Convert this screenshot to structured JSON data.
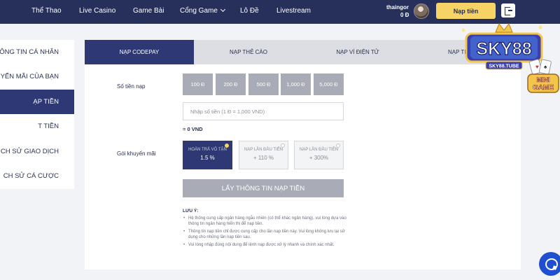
{
  "nav": {
    "items": [
      "Thể Thao",
      "Live Casino",
      "Game Bài",
      "Cổng Game",
      "Lô Đề",
      "Livestream"
    ],
    "user_name": "thaingor",
    "balance": "0 Đ",
    "deposit_label": "Nạp tiền"
  },
  "sidebar": {
    "items": [
      "ÔNG TIN CÁ NHÂN",
      "UYẾN MÃI CỦA BẠN",
      "ẠP TIỀN",
      "T TIỀN",
      "CH SỬ GIAO DỊCH",
      "CH SỬ CÁ CƯỢC"
    ],
    "active_index": 2
  },
  "tabs": {
    "items": [
      "NẠP CODEPAY",
      "NẠP THẺ CÀO",
      "NẠP VÍ ĐIỆN TỬ",
      "NẠP TIỀ"
    ],
    "active_index": 0
  },
  "form": {
    "amount_label": "Số tiền nạp",
    "amount_options": [
      "100 Đ",
      "200 Đ",
      "500 Đ",
      "1,000 Đ",
      "5,000 Đ"
    ],
    "input_placeholder": "Nhập số tiền (1 Đ = 1,000 VND)",
    "converted": "= 0 VND",
    "promo_label": "Gói khuyến mãi",
    "promos": [
      {
        "title": "HOÀN TRẢ VÔ TẬN",
        "value": "1.5 %"
      },
      {
        "title": "NẠP LẦN ĐẦU TIÊN",
        "value": "+ 110 %"
      },
      {
        "title": "NẠP LẦN ĐẦU TIÊN",
        "value": "+ 300%"
      }
    ],
    "promo_active_index": 0,
    "submit_label": "LẤY THÔNG TIN NẠP TIỀN"
  },
  "notes": {
    "title": "LƯU Ý:",
    "items": [
      "Hệ thống cung cấp ngân hàng ngẫu nhiên (có thể khác ngân hàng), vui lòng dựa vào thông tin ngân hàng hiển thị để nạp tiền.",
      "Thông tin nạp tiền chỉ được cung cấp cho lần nạp tiền này. Vui lòng không lưu lại sử dụng cho những lần nạp tiền sau.",
      "Vui lòng nhập đúng nội dung để lệnh nạp được xử lý nhanh và chính xác nhất."
    ]
  },
  "branding": {
    "logo_text": "SKY88",
    "logo_sub": "SKY88.TUBE",
    "mini_game_text_1": "MINI",
    "mini_game_text_2": "GAME"
  },
  "icons": {
    "chevron": "chevron-down-icon",
    "logout": "logout-icon",
    "chat": "chat-icon"
  },
  "colors": {
    "nav_bg": "#27305a",
    "accent": "#2e3874",
    "deposit_button": "#f6d365",
    "chat_button": "#1f4fd1"
  }
}
